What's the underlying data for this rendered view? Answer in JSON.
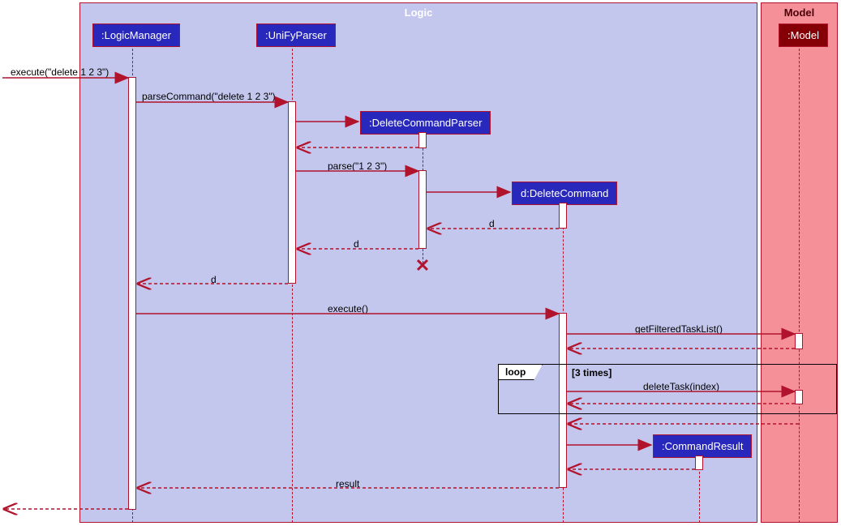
{
  "frames": {
    "logic": "Logic",
    "model": "Model"
  },
  "participants": {
    "logicManager": ":LogicManager",
    "unifyParser": ":UniFyParser",
    "deleteCommandParser": ":DeleteCommandParser",
    "deleteCommand": "d:DeleteCommand",
    "commandResult": ":CommandResult",
    "model": ":Model"
  },
  "messages": {
    "execute_entry": "execute(\"delete 1 2 3\")",
    "parseCommand": "parseCommand(\"delete 1 2 3\")",
    "parse": "parse(\"1 2 3\")",
    "return_d1": "d",
    "return_d2": "d",
    "return_d3": "d",
    "execute": "execute()",
    "getFilteredTaskList": "getFilteredTaskList()",
    "deleteTask": "deleteTask(index)",
    "result": "result"
  },
  "loop": {
    "label": "loop",
    "condition": "[3 times]"
  },
  "chart_data": {
    "type": "sequence_diagram",
    "frames": [
      {
        "name": "Logic",
        "participants": [
          ":LogicManager",
          ":UniFyParser",
          ":DeleteCommandParser",
          "d:DeleteCommand",
          ":CommandResult"
        ]
      },
      {
        "name": "Model",
        "participants": [
          ":Model"
        ]
      }
    ],
    "participants": [
      {
        "id": "LogicManager",
        "label": ":LogicManager",
        "frame": "Logic",
        "preexisting": true
      },
      {
        "id": "UniFyParser",
        "label": ":UniFyParser",
        "frame": "Logic",
        "preexisting": true
      },
      {
        "id": "DeleteCommandParser",
        "label": ":DeleteCommandParser",
        "frame": "Logic",
        "preexisting": false,
        "destroyed": true
      },
      {
        "id": "DeleteCommand",
        "label": "d:DeleteCommand",
        "frame": "Logic",
        "preexisting": false
      },
      {
        "id": "CommandResult",
        "label": ":CommandResult",
        "frame": "Logic",
        "preexisting": false
      },
      {
        "id": "Model",
        "label": ":Model",
        "frame": "Model",
        "preexisting": true
      }
    ],
    "interactions": [
      {
        "from": "external",
        "to": "LogicManager",
        "label": "execute(\"delete 1 2 3\")",
        "type": "call"
      },
      {
        "from": "LogicManager",
        "to": "UniFyParser",
        "label": "parseCommand(\"delete 1 2 3\")",
        "type": "call"
      },
      {
        "from": "UniFyParser",
        "to": "DeleteCommandParser",
        "label": "",
        "type": "create"
      },
      {
        "from": "DeleteCommandParser",
        "to": "UniFyParser",
        "label": "",
        "type": "return"
      },
      {
        "from": "UniFyParser",
        "to": "DeleteCommandParser",
        "label": "parse(\"1 2 3\")",
        "type": "call"
      },
      {
        "from": "DeleteCommandParser",
        "to": "DeleteCommand",
        "label": "",
        "type": "create"
      },
      {
        "from": "DeleteCommand",
        "to": "DeleteCommandParser",
        "label": "d",
        "type": "return"
      },
      {
        "from": "DeleteCommandParser",
        "to": "UniFyParser",
        "label": "d",
        "type": "return"
      },
      {
        "from": "DeleteCommandParser",
        "to": null,
        "label": "",
        "type": "destroy"
      },
      {
        "from": "UniFyParser",
        "to": "LogicManager",
        "label": "d",
        "type": "return"
      },
      {
        "from": "LogicManager",
        "to": "DeleteCommand",
        "label": "execute()",
        "type": "call"
      },
      {
        "from": "DeleteCommand",
        "to": "Model",
        "label": "getFilteredTaskList()",
        "type": "call"
      },
      {
        "from": "Model",
        "to": "DeleteCommand",
        "label": "",
        "type": "return"
      },
      {
        "fragment": "loop",
        "condition": "[3 times]",
        "interactions": [
          {
            "from": "DeleteCommand",
            "to": "Model",
            "label": "deleteTask(index)",
            "type": "call"
          },
          {
            "from": "Model",
            "to": "DeleteCommand",
            "label": "",
            "type": "return"
          }
        ]
      },
      {
        "from": "Model",
        "to": "DeleteCommand",
        "label": "",
        "type": "return"
      },
      {
        "from": "DeleteCommand",
        "to": "CommandResult",
        "label": "",
        "type": "create"
      },
      {
        "from": "CommandResult",
        "to": "DeleteCommand",
        "label": "",
        "type": "return"
      },
      {
        "from": "DeleteCommand",
        "to": "LogicManager",
        "label": "result",
        "type": "return"
      },
      {
        "from": "LogicManager",
        "to": "external",
        "label": "",
        "type": "return"
      }
    ]
  }
}
